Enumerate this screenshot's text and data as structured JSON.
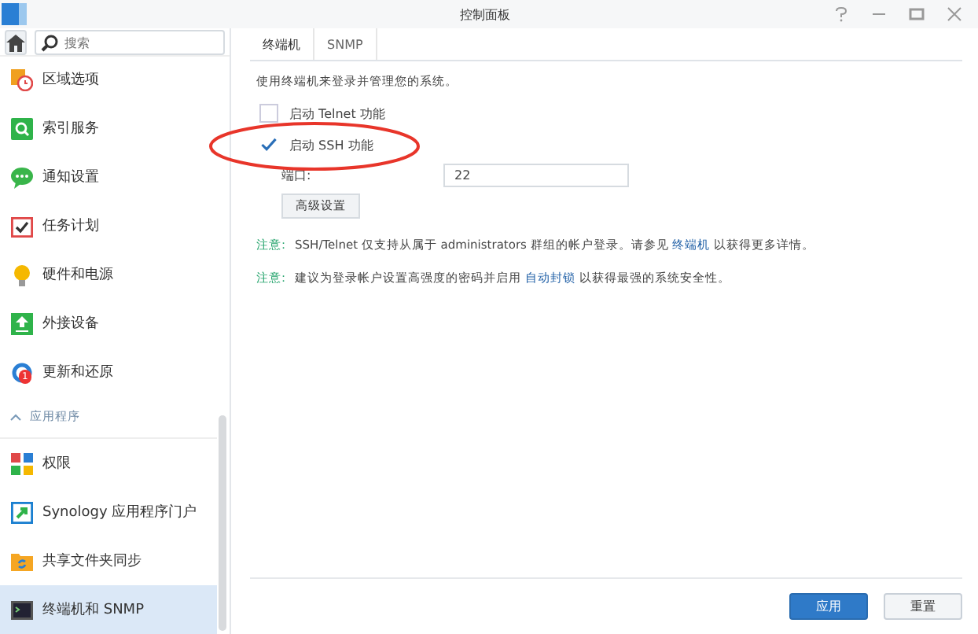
{
  "window": {
    "title": "控制面板"
  },
  "sidebar": {
    "search": {
      "placeholder": "搜索"
    },
    "items": [
      {
        "label": "区域选项",
        "selected": false
      },
      {
        "label": "索引服务",
        "selected": false
      },
      {
        "label": "通知设置",
        "selected": false
      },
      {
        "label": "任务计划",
        "selected": false
      },
      {
        "label": "硬件和电源",
        "selected": false
      },
      {
        "label": "外接设备",
        "selected": false
      },
      {
        "label": "更新和还原",
        "selected": false,
        "badge": "1"
      },
      {
        "kind": "section",
        "label": "应用程序",
        "expanded": true
      },
      {
        "label": "权限",
        "selected": false
      },
      {
        "label": "Synology 应用程序门户",
        "selected": false
      },
      {
        "label": "共享文件夹同步",
        "selected": false
      },
      {
        "label": "终端机和 SNMP",
        "selected": true
      }
    ]
  },
  "tabs": [
    {
      "label": "终端机",
      "selected": true
    },
    {
      "label": "SNMP",
      "selected": false
    }
  ],
  "description": "使用终端机来登录并管理您的系统。",
  "options": [
    {
      "label": "启动 Telnet 功能",
      "checked": false
    },
    {
      "label": "启动 SSH 功能",
      "checked": true
    }
  ],
  "port": {
    "label": "端口:",
    "value": "22"
  },
  "advanced_button": "高级设置",
  "notes": [
    {
      "label": "注意:",
      "before": "SSH/Telnet 仅支持从属于 administrators 群组的帐户登录。请参见 ",
      "link": "终端机",
      "after": " 以获得更多详情。"
    },
    {
      "label": "注意:",
      "before": "建议为登录帐户设置高强度的密码并启用 ",
      "link": "自动封锁",
      "after": " 以获得最强的系统安全性。"
    }
  ],
  "buttons": [
    {
      "label": "应用",
      "kind": "primary"
    },
    {
      "label": "重置",
      "kind": "secondary"
    }
  ]
}
